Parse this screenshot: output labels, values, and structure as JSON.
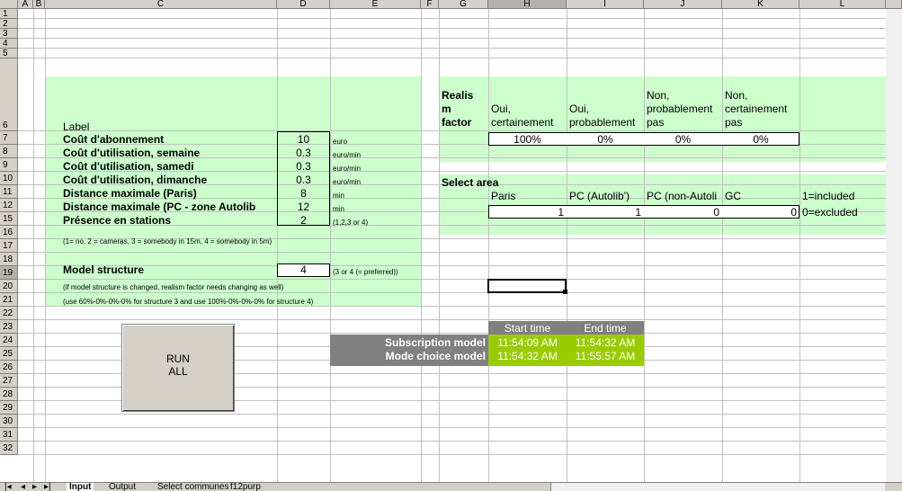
{
  "columns": [
    "A",
    "B",
    "C",
    "D",
    "E",
    "F",
    "G",
    "H",
    "I",
    "J",
    "K",
    "L"
  ],
  "rows": [
    "1",
    "2",
    "3",
    "4",
    "5",
    "6",
    "7",
    "8",
    "9",
    "10",
    "11",
    "12",
    "15",
    "16",
    "17",
    "18",
    "19",
    "20",
    "21",
    "22",
    "23",
    "24",
    "25",
    "26",
    "27",
    "28",
    "29",
    "30",
    "31",
    "32"
  ],
  "params": {
    "label_header": "Label",
    "items": [
      {
        "label": "Coût d'abonnement",
        "value": "10",
        "unit": "euro"
      },
      {
        "label": "Coût d'utilisation, semaine",
        "value": "0.3",
        "unit": "euro/min"
      },
      {
        "label": "Coût d'utilisation, samedi",
        "value": "0.3",
        "unit": "euro/min"
      },
      {
        "label": "Coût d'utilisation, dimanche",
        "value": "0.3",
        "unit": "euro/min"
      },
      {
        "label": "Distance maximale (Paris)",
        "value": "8",
        "unit": "min"
      },
      {
        "label": "Distance maximale (PC - zone Autolib",
        "value": "12",
        "unit": "min"
      },
      {
        "label": "Présence en stations",
        "value": "2",
        "unit": "(1,2,3 or 4)"
      }
    ],
    "presence_note": "(1= no, 2 = cameras, 3 = somebody in 15m, 4 = somebody in 5m)",
    "model_structure_label": "Model structure",
    "model_structure_value": "4",
    "model_structure_unit": "(3 or 4 (= preferred))",
    "note1": "(if model structure is changed, realism factor needs changing as well)",
    "note2": "(use 60%-0%-0%-0% for structure 3 and use 100%-0%-0%-0% for structure 4)"
  },
  "realism": {
    "label_l1": "Realis",
    "label_l2": "m",
    "label_l3": "factor",
    "headers": [
      {
        "l1": "",
        "l2": "Oui,",
        "l3": "certainement"
      },
      {
        "l1": "",
        "l2": "Oui,",
        "l3": "probablement"
      },
      {
        "l1": "Non,",
        "l2": "probablement",
        "l3": "pas"
      },
      {
        "l1": "Non,",
        "l2": "certainement",
        "l3": "pas"
      }
    ],
    "values": [
      "100%",
      "0%",
      "0%",
      "0%"
    ]
  },
  "area": {
    "title": "Select area",
    "headers": [
      "Paris",
      "PC (Autolib')",
      "PC (non-Autoli",
      "GC"
    ],
    "values": [
      "1",
      "1",
      "0",
      "0"
    ],
    "legend_included": "1=included",
    "legend_excluded": "0=excluded"
  },
  "timing": {
    "col_start": "Start time",
    "col_end": "End time",
    "rows": [
      {
        "name": "Subscription model",
        "start": "11:54:09 AM",
        "end": "11:54:32 AM"
      },
      {
        "name": "Mode choice model",
        "start": "11:54:32 AM",
        "end": "11:55:57 AM"
      }
    ]
  },
  "run_button": {
    "line1": "RUN",
    "line2": "ALL"
  },
  "tabs": [
    "Input",
    "Output",
    "Select communes",
    "f12purp"
  ],
  "colors": {
    "panel": "#ccffcc",
    "dark": "#808080",
    "timegreen": "#99cc00"
  }
}
